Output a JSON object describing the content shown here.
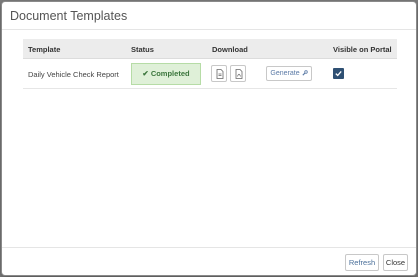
{
  "modal": {
    "title": "Document Templates"
  },
  "table": {
    "columns": {
      "template": "Template",
      "status": "Status",
      "download": "Download",
      "visible_on_portal": "Visible on Portal"
    },
    "rows": [
      {
        "template": "Daily Vehicle Check Report",
        "status": "Completed",
        "generate_label": "Generate",
        "visible_on_portal": true
      }
    ]
  },
  "footer": {
    "refresh_label": "Refresh",
    "close_label": "Close"
  },
  "colors": {
    "status_bg": "#dff0d8",
    "status_text": "#3c763d",
    "checkbox": "#2f5073",
    "link_text": "#5b7aa6"
  },
  "icons": [
    "check-icon",
    "document-icon",
    "pdf-icon",
    "wrench-icon",
    "checkbox-checked-icon"
  ]
}
